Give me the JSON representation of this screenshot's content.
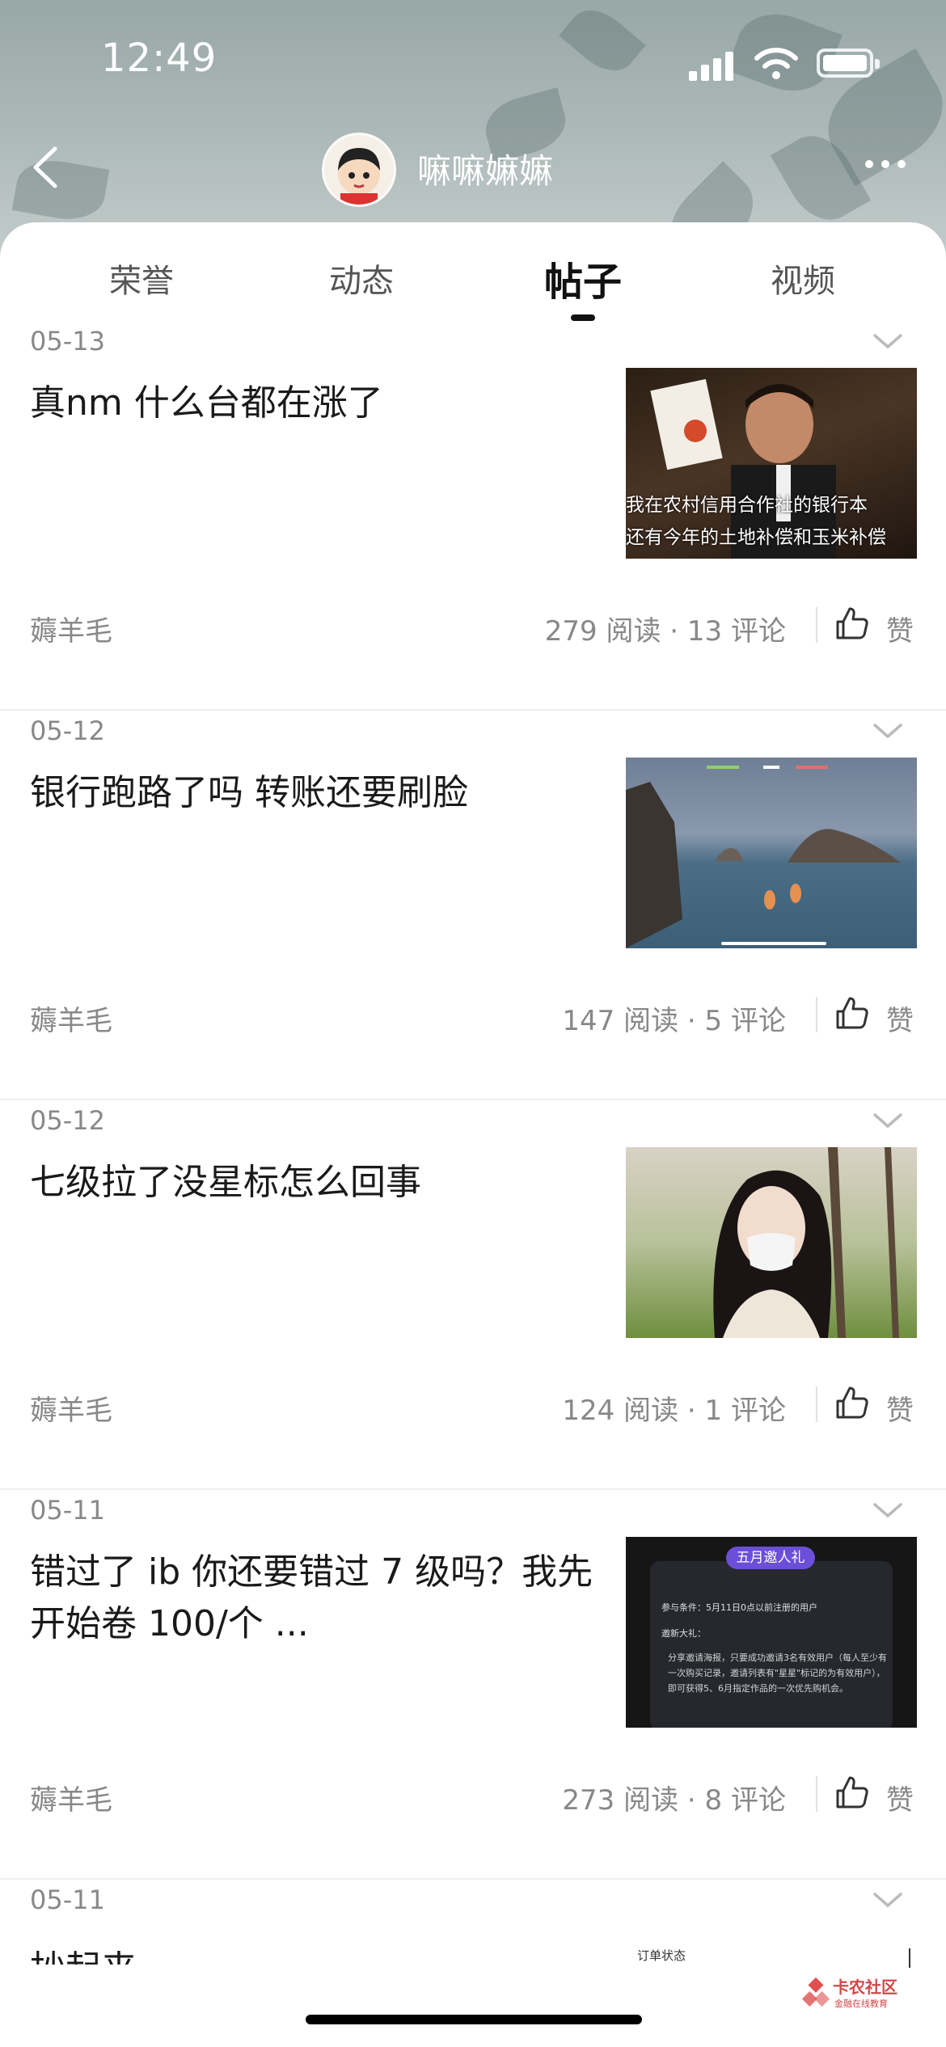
{
  "status_bar": {
    "time": "12:49"
  },
  "header": {
    "username": "嘛嘛嫲嫲"
  },
  "tabs": [
    {
      "label": "荣誉"
    },
    {
      "label": "动态"
    },
    {
      "label": "帖子"
    },
    {
      "label": "视频"
    }
  ],
  "active_tab": "帖子",
  "posts": [
    {
      "date": "05-13",
      "title": "真nm 什么台都在涨了",
      "source": "薅羊毛",
      "stats": "279 阅读 · 13 评论",
      "like_label": "赞",
      "thumb_caption_1": "我在农村信用合作社的银行本",
      "thumb_caption_2": "还有今年的土地补偿和玉米补偿"
    },
    {
      "date": "05-12",
      "title": "银行跑路了吗 转账还要刷脸",
      "source": "薅羊毛",
      "stats": "147 阅读 · 5 评论",
      "like_label": "赞"
    },
    {
      "date": "05-12",
      "title": "七级拉了没星标怎么回事",
      "source": "薅羊毛",
      "stats": "124 阅读 · 1 评论",
      "like_label": "赞"
    },
    {
      "date": "05-11",
      "title": "错过了 ib 你还要错过 7 级吗？我先开始卷 100/个 ...",
      "source": "薅羊毛",
      "stats": "273 阅读 · 8 评论",
      "like_label": "赞",
      "thumb_badge": "五月邀人礼",
      "thumb_line_1": "参与条件：5月11日0点以前注册的用户",
      "thumb_line_2": "邀新大礼：",
      "thumb_line_3": "分享邀请海报，只要成功邀请3名有效用户（每人至少有一次购买记录，邀请列表有\"星星\"标记的为有效用户），即可获得5、6月指定作品的一次优先购机会。"
    },
    {
      "date": "05-11",
      "title": "抄起来"
    }
  ],
  "overlay": {
    "order_status": "订单状态",
    "watermark_main": "卡农社区",
    "watermark_sub": "金融在线教育"
  },
  "colors": {
    "accent_text": "#111111",
    "secondary_text": "#888888",
    "divider": "#eeeeee"
  }
}
